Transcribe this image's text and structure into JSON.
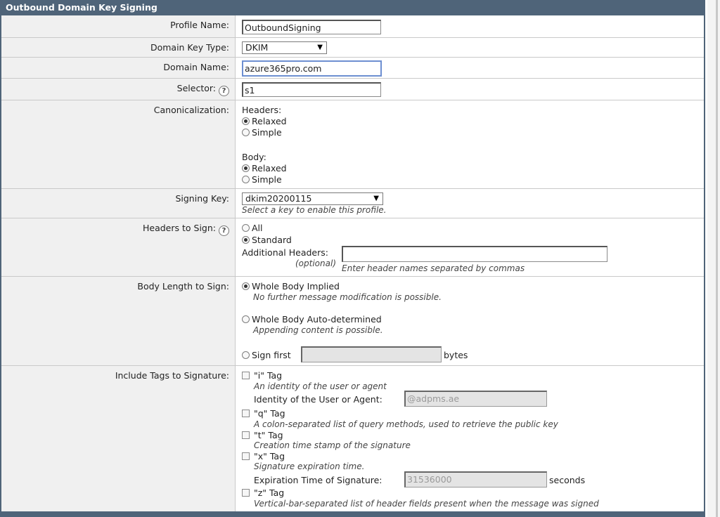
{
  "title": "Outbound Domain Key Signing",
  "profile_name": {
    "label": "Profile Name:",
    "value": "OutboundSigning"
  },
  "domain_key_type": {
    "label": "Domain Key Type:",
    "value": "DKIM"
  },
  "domain_name": {
    "label": "Domain Name:",
    "value": "azure365pro.com"
  },
  "selector": {
    "label": "Selector:",
    "value": "s1",
    "help_icon": "?"
  },
  "canonicalization": {
    "label": "Canonicalization:",
    "headers_label": "Headers:",
    "headers_options": [
      {
        "label": "Relaxed",
        "checked": true
      },
      {
        "label": "Simple",
        "checked": false
      }
    ],
    "body_label": "Body:",
    "body_options": [
      {
        "label": "Relaxed",
        "checked": true
      },
      {
        "label": "Simple",
        "checked": false
      }
    ]
  },
  "signing_key": {
    "label": "Signing Key:",
    "value": "dkim20200115",
    "hint": "Select a key to enable this profile."
  },
  "headers_to_sign": {
    "label": "Headers to Sign:",
    "help_icon": "?",
    "options": [
      {
        "label": "All",
        "checked": false
      },
      {
        "label": "Standard",
        "checked": true
      }
    ],
    "additional_label": "Additional Headers:",
    "optional_label": "(optional)",
    "additional_value": "",
    "additional_hint": "Enter header names separated by commas"
  },
  "body_length": {
    "label": "Body Length to Sign:",
    "whole_implied": {
      "label": "Whole Body Implied",
      "hint": "No further message modification is possible.",
      "checked": true
    },
    "whole_auto": {
      "label": "Whole Body Auto-determined",
      "hint": "Appending content is possible.",
      "checked": false
    },
    "sign_first": {
      "label": "Sign first",
      "value": "",
      "unit": "bytes",
      "checked": false
    }
  },
  "include_tags": {
    "label": "Include Tags to Signature:",
    "i_tag": {
      "label": "\"i\" Tag",
      "hint": "An identity of the user or agent",
      "identity_label": "Identity of the User or Agent:",
      "identity_value": "@adpms.ae"
    },
    "q_tag": {
      "label": "\"q\" Tag",
      "hint": "A colon-separated list of query methods, used to retrieve the public key"
    },
    "t_tag": {
      "label": "\"t\" Tag",
      "hint": "Creation time stamp of the signature"
    },
    "x_tag": {
      "label": "\"x\" Tag",
      "hint": "Signature expiration time.",
      "expiration_label": "Expiration Time of Signature:",
      "expiration_value": "31536000",
      "unit": "seconds"
    },
    "z_tag": {
      "label": "\"z\" Tag",
      "hint": "Vertical-bar-separated list of header fields present when the message was signed"
    }
  }
}
